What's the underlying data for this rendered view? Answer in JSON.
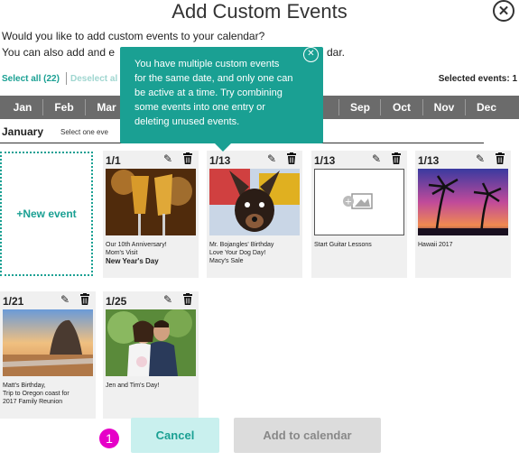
{
  "dialog": {
    "title": "Add Custom Events",
    "close_icon": "close-circle-icon"
  },
  "intro": {
    "line1": "Would you like to add custom events to your calendar?",
    "line2a": "You can also add and e",
    "line2b": "dar."
  },
  "selection": {
    "select_all": "Select all (22)",
    "deselect_all": "Deselect al",
    "selected_events": "Selected events: 1"
  },
  "months": [
    "Jan",
    "Feb",
    "Mar",
    "",
    "",
    "",
    "",
    "g",
    "Sep",
    "Oct",
    "Nov",
    "Dec"
  ],
  "section": {
    "month": "January",
    "hint": "Select one eve"
  },
  "new_event": {
    "label": "+New event"
  },
  "cards": [
    {
      "date": "1/1",
      "photo": "champagne",
      "lines": [
        "Our 10th Anniversary!",
        "Mom's Visit",
        "New Year's Day"
      ],
      "bold_last": true
    },
    {
      "date": "1/13",
      "photo": "dog",
      "lines": [
        "Mr. Bojangles' Birthday",
        "Love Your Dog Day!",
        "Macy's Sale"
      ],
      "bold_last": false
    },
    {
      "date": "1/13",
      "photo": "placeholder",
      "lines": [
        "Start Guitar Lessons"
      ],
      "bold_last": false
    },
    {
      "date": "1/13",
      "photo": "palms",
      "lines": [
        "Hawaii 2017"
      ],
      "bold_last": false
    },
    {
      "date": "1/21",
      "photo": "beach",
      "lines": [
        "Matt's Birthday,",
        "Trip to Oregon coast for",
        "2017 Family Reunion"
      ],
      "bold_last": false
    },
    {
      "date": "1/25",
      "photo": "couple",
      "lines": [
        "Jen and Tim's Day!"
      ],
      "bold_last": false
    }
  ],
  "tooltip": {
    "line1": "You have multiple custom events",
    "line2": "for the same date, and only one can",
    "line3": "be active at a time. Try combining",
    "line4": "some events into one entry or",
    "line5": "deleting unused events.",
    "close_icon": "close-circle-icon"
  },
  "buttons": {
    "cancel": "Cancel",
    "add": "Add to calendar"
  },
  "marker": {
    "number": "1"
  },
  "colors": {
    "accent": "#1aa093",
    "month_bar": "#6b6b6b",
    "marker": "#e600c8",
    "card_bg": "#f0f0f0"
  }
}
